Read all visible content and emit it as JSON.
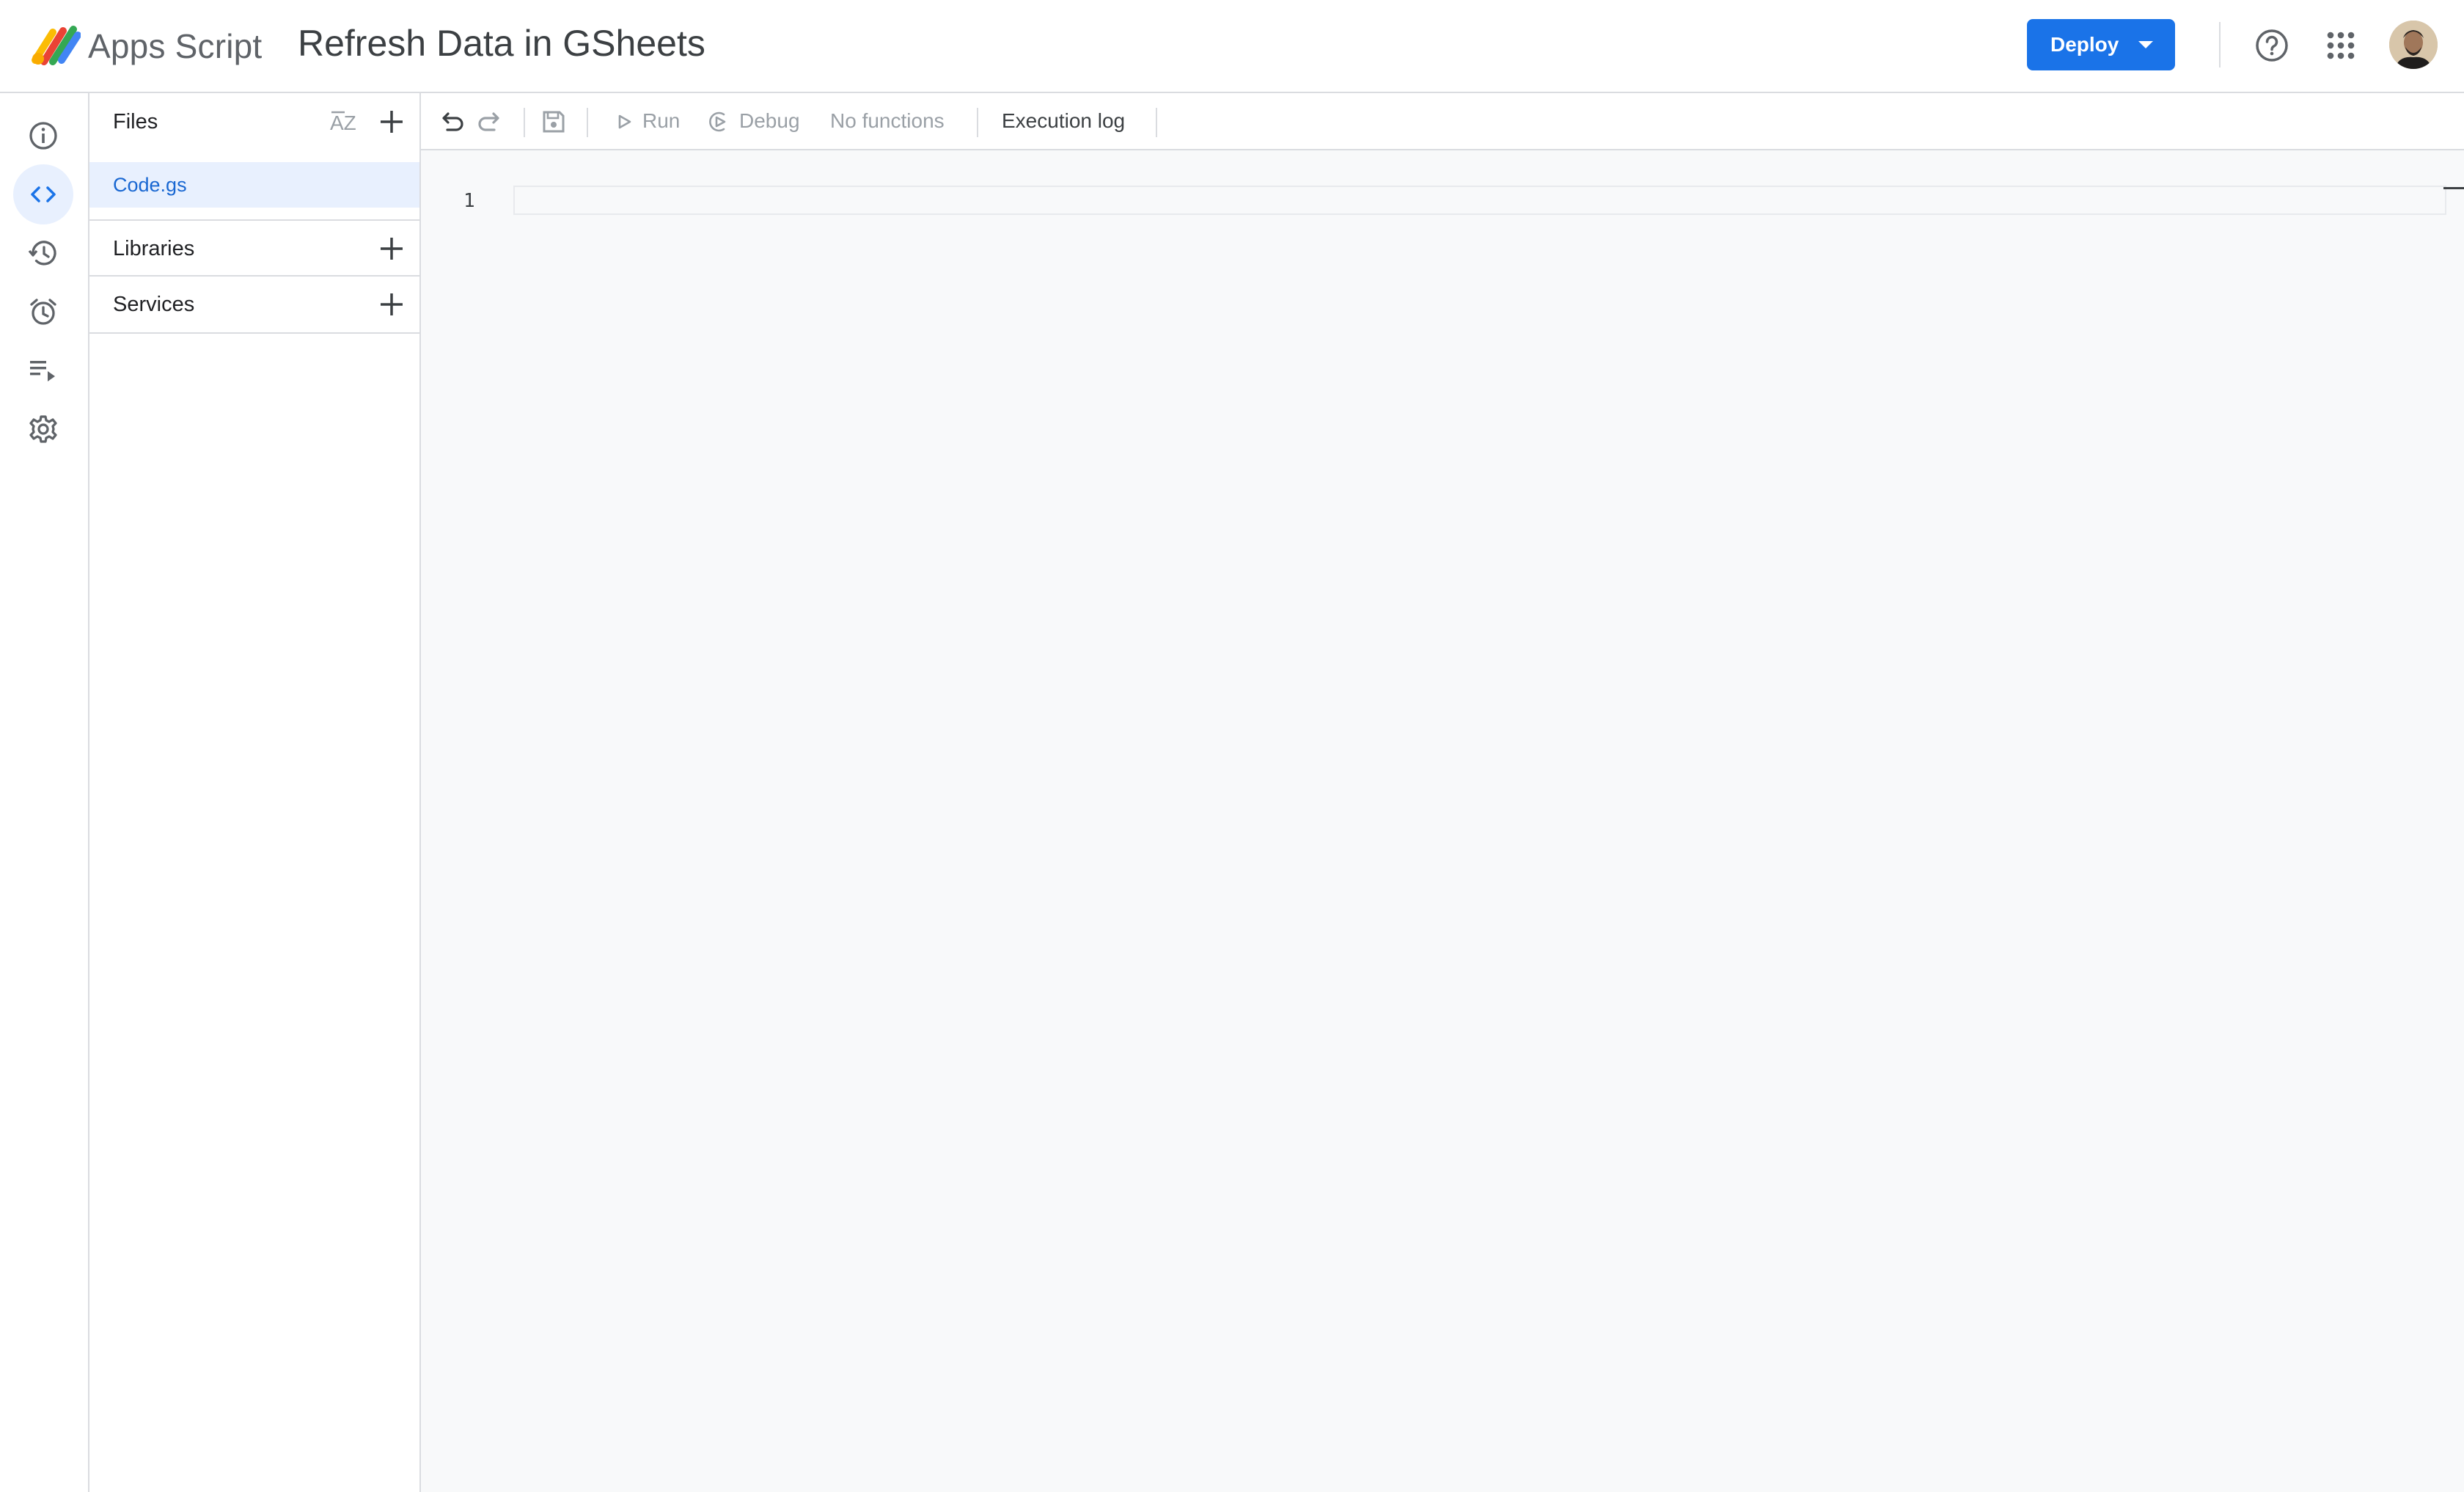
{
  "header": {
    "product_name": "Apps Script",
    "project_title": "Refresh Data in GSheets",
    "deploy_label": "Deploy",
    "brand_color": "#1a73e8"
  },
  "rail": {
    "items": [
      {
        "id": "overview",
        "icon": "info-icon"
      },
      {
        "id": "editor",
        "icon": "code-icon",
        "active": true
      },
      {
        "id": "project-history",
        "icon": "history-icon"
      },
      {
        "id": "triggers",
        "icon": "alarm-icon"
      },
      {
        "id": "executions",
        "icon": "executions-icon"
      },
      {
        "id": "settings",
        "icon": "gear-icon"
      }
    ]
  },
  "files_panel": {
    "files_label": "Files",
    "sort_icon": "sort-az-icon",
    "files": [
      {
        "name": "Code.gs",
        "selected": true
      }
    ],
    "libraries_label": "Libraries",
    "services_label": "Services"
  },
  "toolbar": {
    "run_label": "Run",
    "debug_label": "Debug",
    "function_select": "No functions",
    "execution_log_label": "Execution log"
  },
  "editor": {
    "line_numbers": [
      "1"
    ]
  }
}
